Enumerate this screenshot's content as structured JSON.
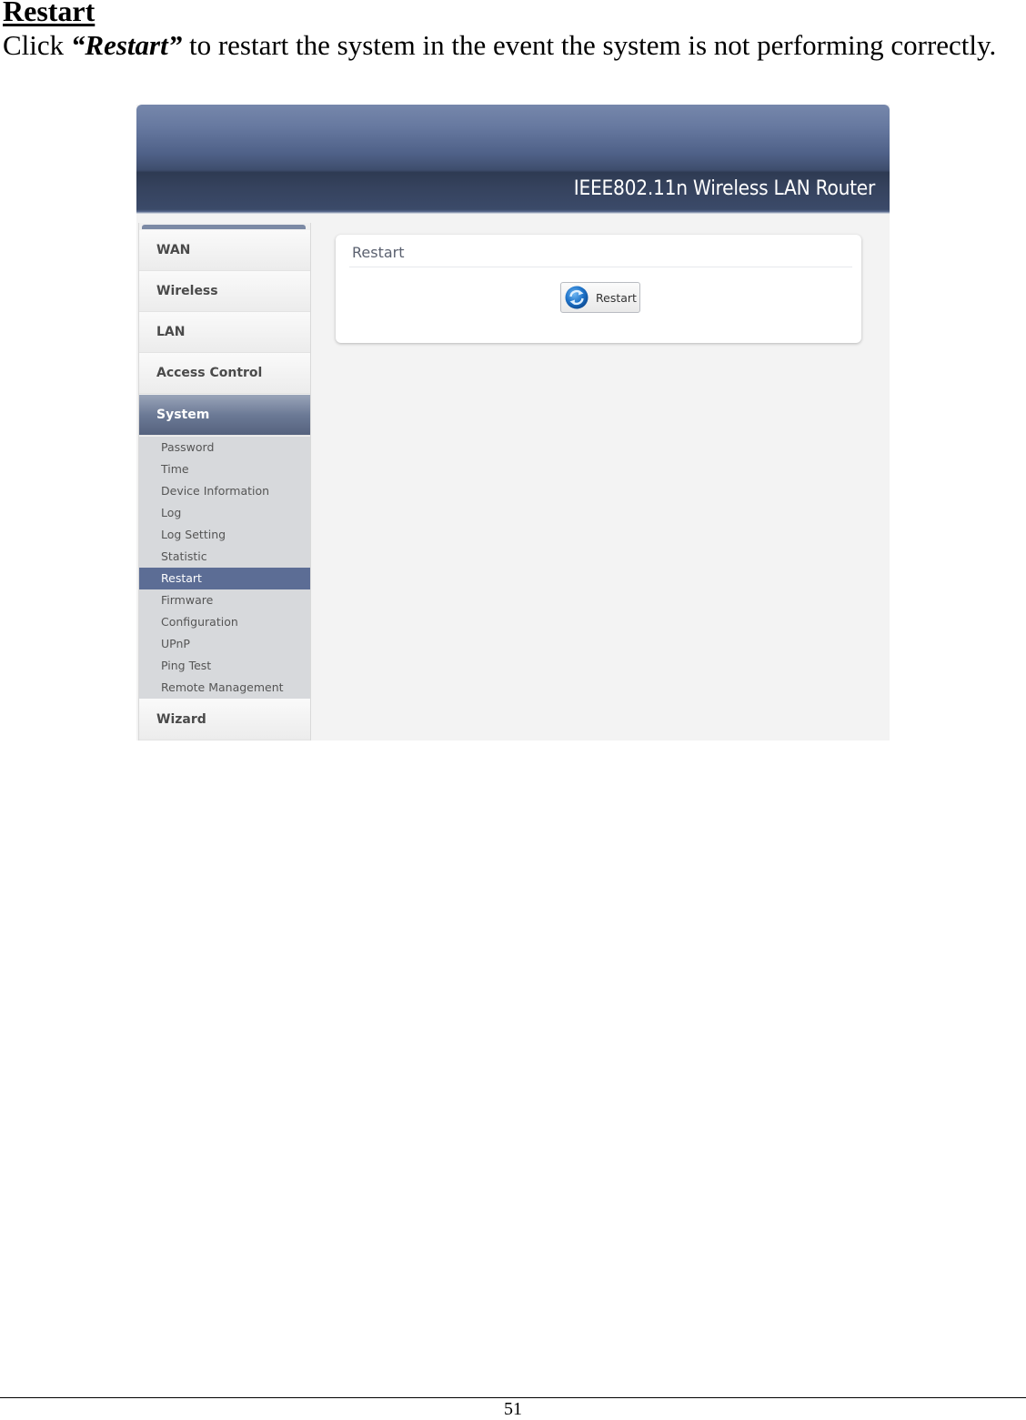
{
  "document": {
    "heading": "Restart",
    "para_prefix": "Click ",
    "para_emphasis": "“Restart”",
    "para_suffix": " to restart the system in the event the system is not performing correctly.",
    "page_number": "51"
  },
  "router_ui": {
    "banner_title": "IEEE802.11n  Wireless LAN Router",
    "nav_main": [
      {
        "label": "WAN"
      },
      {
        "label": "Wireless"
      },
      {
        "label": "LAN"
      },
      {
        "label": "Access Control"
      },
      {
        "label": "System",
        "active": true
      },
      {
        "label": "Wizard"
      }
    ],
    "system_submenu": [
      {
        "label": "Password"
      },
      {
        "label": "Time"
      },
      {
        "label": "Device Information"
      },
      {
        "label": "Log"
      },
      {
        "label": "Log Setting"
      },
      {
        "label": "Statistic"
      },
      {
        "label": "Restart",
        "active": true
      },
      {
        "label": "Firmware"
      },
      {
        "label": "Configuration"
      },
      {
        "label": "UPnP"
      },
      {
        "label": "Ping Test"
      },
      {
        "label": "Remote Management"
      }
    ],
    "panel": {
      "title": "Restart",
      "button_label": "Restart",
      "button_icon": "refresh-icon"
    },
    "colors": {
      "banner_dark": "#2e3a52",
      "active_nav": "#5c6d95",
      "submenu_bg": "#d7d9dc",
      "content_bg": "#f3f3f3"
    }
  }
}
